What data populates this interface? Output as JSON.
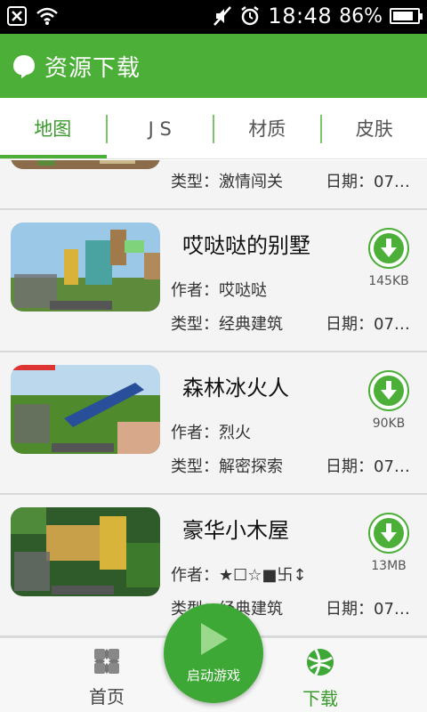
{
  "status_bar": {
    "time": "18:48",
    "battery_percent": "86%",
    "battery_level": 0.86
  },
  "header": {
    "title": "资源下载"
  },
  "tabs": [
    {
      "label": "地图",
      "active": true
    },
    {
      "label": "J S",
      "active": false
    },
    {
      "label": "材质",
      "active": false
    },
    {
      "label": "皮肤",
      "active": false
    }
  ],
  "partial_item": {
    "type": "类型：激情闯关",
    "date": "日期：07…"
  },
  "items": [
    {
      "title": "哎哒哒的别墅",
      "author": "作者：哎哒哒",
      "type": "类型：经典建筑",
      "date": "日期：07…",
      "size": "145KB"
    },
    {
      "title": "森林冰火人",
      "author": "作者：烈火",
      "type": "类型：解密探索",
      "date": "日期：07…",
      "size": "90KB"
    },
    {
      "title": "豪华小木屋",
      "author": "作者：★☐☆■卐↕",
      "type": "类型：经典建筑",
      "date": "日期：07…",
      "size": "13MB"
    }
  ],
  "bottom_nav": {
    "home_label": "首页",
    "launch_label": "启动游戏",
    "download_label": "下载"
  },
  "colors": {
    "accent": "#4caf38",
    "status_bar": "#000000",
    "tab_active": "#3a9b2c"
  },
  "icons": [
    "close-notification-icon",
    "wifi-icon",
    "mute-icon",
    "alarm-icon",
    "battery-icon",
    "logo-icon",
    "download-icon",
    "play-icon",
    "home-grid-icon",
    "globe-icon"
  ]
}
